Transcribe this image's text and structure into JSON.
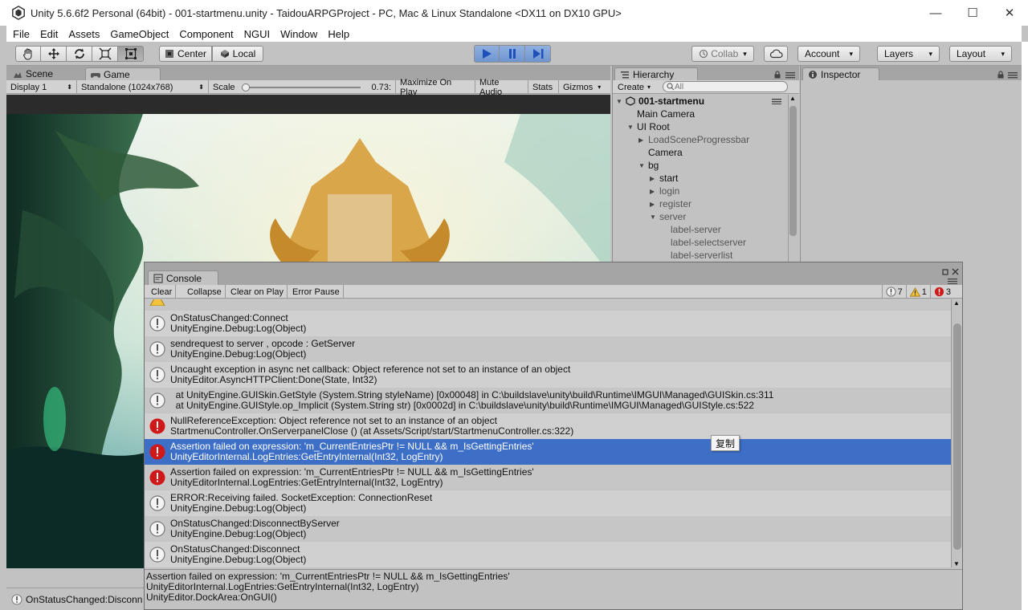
{
  "window": {
    "title": "Unity 5.6.6f2 Personal (64bit) - 001-startmenu.unity - TaidouARPGProject - PC, Mac & Linux Standalone <DX11 on DX10 GPU>",
    "minimize": "—",
    "maximize": "☐",
    "close": "✕"
  },
  "menu": [
    "File",
    "Edit",
    "Assets",
    "GameObject",
    "Component",
    "NGUI",
    "Window",
    "Help"
  ],
  "toolbar": {
    "center_label": "Center",
    "local_label": "Local",
    "collab_label": "Collab",
    "account_label": "Account",
    "layers_label": "Layers",
    "layout_label": "Layout"
  },
  "game_panel": {
    "scene_tab": "Scene",
    "game_tab": "Game",
    "display": "Display 1",
    "resolution": "Standalone (1024x768)",
    "scale_label": "Scale",
    "scale_value": "0.73:",
    "scale_fraction": 0.0,
    "maximize_on_play": "Maximize On Play",
    "mute_audio": "Mute Audio",
    "stats": "Stats",
    "gizmos": "Gizmos",
    "status_message": "OnStatusChanged:Disconn"
  },
  "hierarchy": {
    "tab": "Hierarchy",
    "create": "Create",
    "search_placeholder": "All",
    "scene": "001-startmenu",
    "items": [
      {
        "label": "Main Camera"
      },
      {
        "label": "UI Root"
      },
      {
        "label": "LoadSceneProgressbar"
      },
      {
        "label": "Camera"
      },
      {
        "label": "bg"
      },
      {
        "label": "start"
      },
      {
        "label": "login"
      },
      {
        "label": "register"
      },
      {
        "label": "server"
      },
      {
        "label": "label-server"
      },
      {
        "label": "label-selectserver"
      },
      {
        "label": "label-serverlist"
      }
    ]
  },
  "inspector": {
    "tab": "Inspector"
  },
  "console": {
    "tab": "Console",
    "clear": "Clear",
    "collapse": "Collapse",
    "clear_on_play": "Clear on Play",
    "error_pause": "Error Pause",
    "log_count": "7",
    "warning_count": "1",
    "error_count": "3",
    "entries": [
      {
        "type": "log",
        "line1": "OnStatusChanged:Connect",
        "line2": "UnityEngine.Debug:Log(Object)"
      },
      {
        "type": "log",
        "line1": "sendrequest to server , opcode : GetServer",
        "line2": "UnityEngine.Debug:Log(Object)"
      },
      {
        "type": "log",
        "line1": "Uncaught exception in async net callback: Object reference not set to an instance of an object",
        "line2": "UnityEditor.AsyncHTTPClient:Done(State, Int32)"
      },
      {
        "type": "log",
        "line1": "  at UnityEngine.GUISkin.GetStyle (System.String styleName) [0x00048] in C:\\buildslave\\unity\\build\\Runtime\\IMGUI\\Managed\\GUISkin.cs:311",
        "line2": "  at UnityEngine.GUIStyle.op_Implicit (System.String str) [0x0002d] in C:\\buildslave\\unity\\build\\Runtime\\IMGUI\\Managed\\GUIStyle.cs:522"
      },
      {
        "type": "error",
        "line1": "NullReferenceException: Object reference not set to an instance of an object",
        "line2": "StartmenuController.OnServerpanelClose () (at Assets/Script/start/StartmenuController.cs:322)"
      },
      {
        "type": "error",
        "selected": true,
        "line1": "Assertion failed on expression: 'm_CurrentEntriesPtr != NULL && m_IsGettingEntries'",
        "line2": "UnityEditorInternal.LogEntries:GetEntryInternal(Int32, LogEntry)"
      },
      {
        "type": "error",
        "line1": "Assertion failed on expression: 'm_CurrentEntriesPtr != NULL && m_IsGettingEntries'",
        "line2": "UnityEditorInternal.LogEntries:GetEntryInternal(Int32, LogEntry)"
      },
      {
        "type": "log",
        "line1": "ERROR:Receiving failed. SocketException: ConnectionReset",
        "line2": "UnityEngine.Debug:Log(Object)"
      },
      {
        "type": "log",
        "line1": "OnStatusChanged:DisconnectByServer",
        "line2": "UnityEngine.Debug:Log(Object)"
      },
      {
        "type": "log",
        "line1": "OnStatusChanged:Disconnect",
        "line2": "UnityEngine.Debug:Log(Object)"
      }
    ],
    "detail": "Assertion failed on expression: 'm_CurrentEntriesPtr != NULL && m_IsGettingEntries'\nUnityEditorInternal.LogEntries:GetEntryInternal(Int32, LogEntry)\nUnityEditor.DockArea:OnGUI()",
    "tooltip": "复制"
  },
  "colors": {
    "selection": "#3d6fc7",
    "error_red": "#d01818",
    "play_blue": "#2a62d0"
  }
}
